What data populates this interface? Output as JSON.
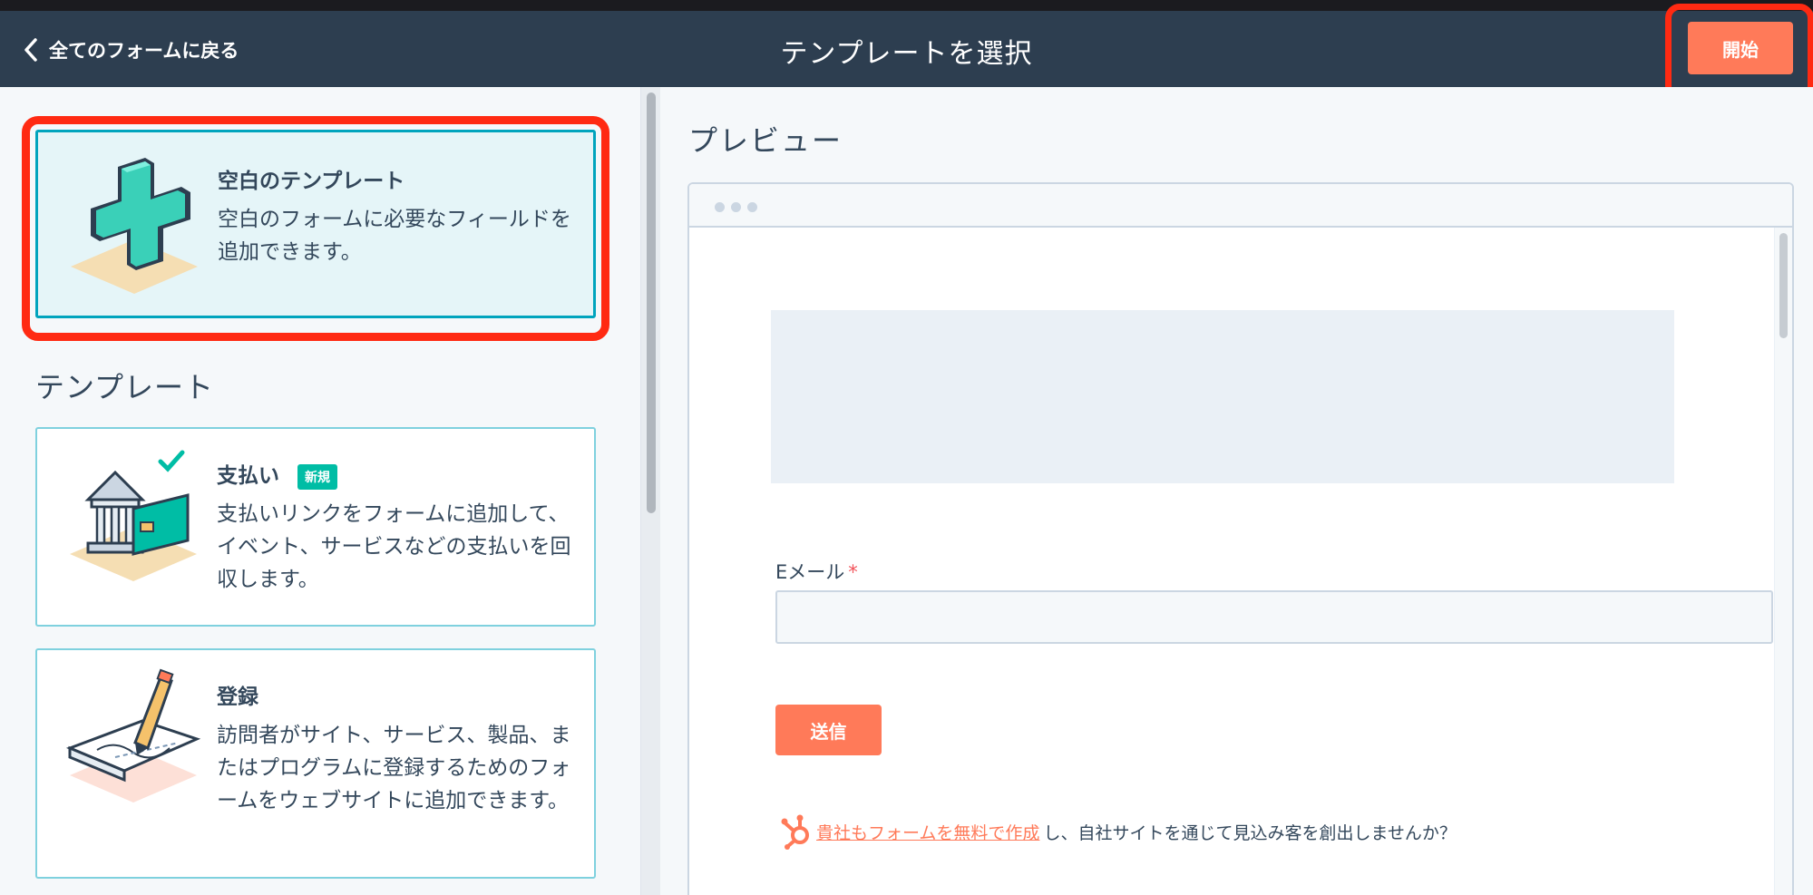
{
  "header": {
    "back_label": "全てのフォームに戻る",
    "title": "テンプレートを選択",
    "start_label": "開始"
  },
  "blank_template": {
    "title": "空白のテンプレート",
    "description": "空白のフォームに必要なフィールドを追加できます。"
  },
  "templates_heading": "テンプレート",
  "templates": [
    {
      "title": "支払い",
      "badge": "新規",
      "description": "支払いリンクをフォームに追加して、イベント、サービスなどの支払いを回収します。"
    },
    {
      "title": "登録",
      "description": "訪問者がサイト、サービス、製品、またはプログラムに登録するためのフォームをウェブサイトに追加できます。"
    }
  ],
  "preview": {
    "heading": "プレビュー",
    "email_label": "Eメール",
    "required_mark": "*",
    "email_value": "",
    "submit_label": "送信",
    "footer_link": "貴社もフォームを無料で作成",
    "footer_text": "し、自社サイトを通じて見込み客を創出しませんか？"
  },
  "colors": {
    "header_bg": "#2d3e50",
    "accent": "#ff7a59",
    "selected_border": "#00a4bd",
    "highlight": "#ff2a12",
    "badge": "#00bda5"
  }
}
